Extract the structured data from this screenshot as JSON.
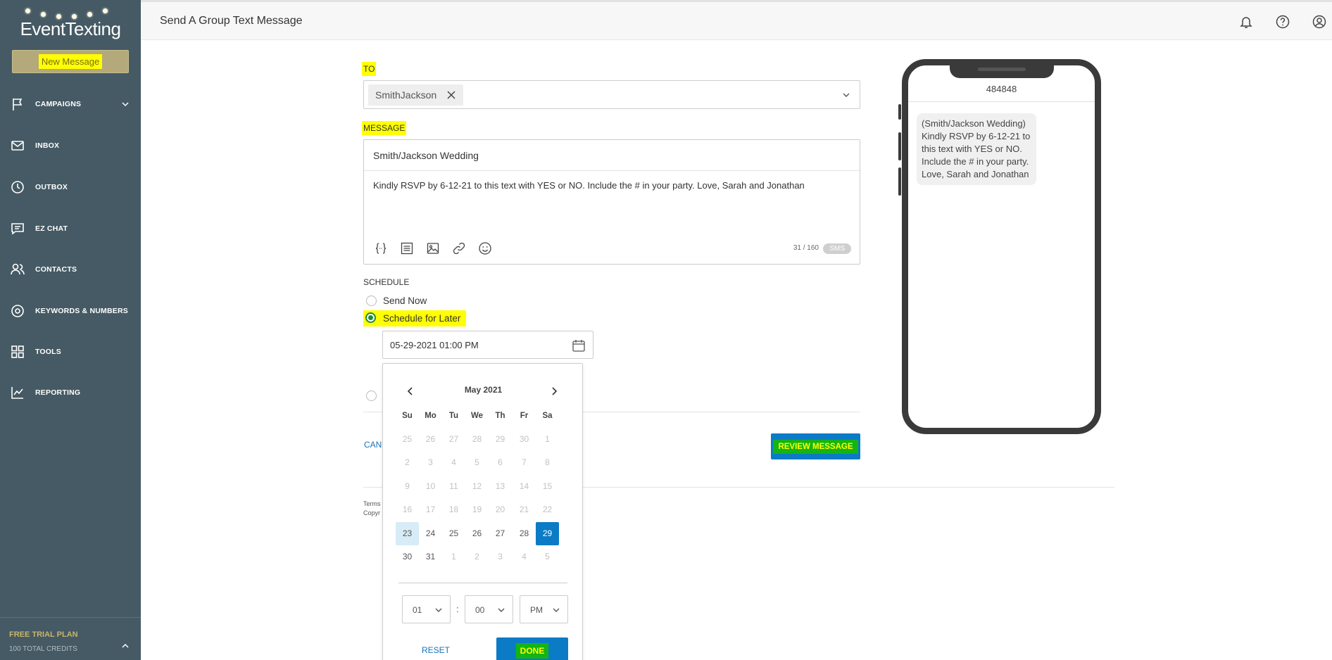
{
  "app": {
    "logo_text": "EventTexting",
    "page_title": "Send A Group Text Message"
  },
  "sidebar": {
    "new_message": "New Message",
    "items": [
      {
        "label": "CAMPAIGNS",
        "icon": "flag-icon"
      },
      {
        "label": "INBOX",
        "icon": "envelope-icon"
      },
      {
        "label": "OUTBOX",
        "icon": "clock-icon"
      },
      {
        "label": "EZ CHAT",
        "icon": "chat-icon"
      },
      {
        "label": "CONTACTS",
        "icon": "people-icon"
      },
      {
        "label": "KEYWORDS & NUMBERS",
        "icon": "target-icon"
      },
      {
        "label": "TOOLS",
        "icon": "grid-icon"
      },
      {
        "label": "REPORTING",
        "icon": "chart-icon"
      }
    ],
    "plan": "FREE TRIAL PLAN",
    "credits": "100 TOTAL CREDITS"
  },
  "form": {
    "to_label": "TO",
    "to_chip": "SmithJackson",
    "message_label": "MESSAGE",
    "subject": "Smith/Jackson Wedding",
    "body": "Kindly RSVP by 6-12-21 to this text with YES or NO. Include the # in your party. Love, Sarah and Jonathan",
    "counter": "31 / 160",
    "badge": "SMS",
    "schedule_label": "SCHEDULE",
    "send_now": "Send Now",
    "schedule_later": "Schedule for Later",
    "datetime": "05-29-2021 01:00 PM",
    "cancel": "CANC",
    "review": "REVIEW MESSAGE",
    "terms": "Terms",
    "copyright": "Copyr"
  },
  "datepicker": {
    "month": "May 2021",
    "dow": [
      "Su",
      "Mo",
      "Tu",
      "We",
      "Th",
      "Fr",
      "Sa"
    ],
    "weeks": [
      [
        [
          "25",
          "m"
        ],
        [
          "26",
          "m"
        ],
        [
          "27",
          "m"
        ],
        [
          "28",
          "m"
        ],
        [
          "29",
          "m"
        ],
        [
          "30",
          "m"
        ],
        [
          "1",
          "m"
        ]
      ],
      [
        [
          "2",
          "m"
        ],
        [
          "3",
          "m"
        ],
        [
          "4",
          "m"
        ],
        [
          "5",
          "m"
        ],
        [
          "6",
          "m"
        ],
        [
          "7",
          "m"
        ],
        [
          "8",
          "m"
        ]
      ],
      [
        [
          "9",
          "m"
        ],
        [
          "10",
          "m"
        ],
        [
          "11",
          "m"
        ],
        [
          "12",
          "m"
        ],
        [
          "13",
          "m"
        ],
        [
          "14",
          "m"
        ],
        [
          "15",
          "m"
        ]
      ],
      [
        [
          "16",
          "m"
        ],
        [
          "17",
          "m"
        ],
        [
          "18",
          "m"
        ],
        [
          "19",
          "m"
        ],
        [
          "20",
          "m"
        ],
        [
          "21",
          "m"
        ],
        [
          "22",
          "m"
        ]
      ],
      [
        [
          "23",
          "today"
        ],
        [
          "24",
          ""
        ],
        [
          "25",
          ""
        ],
        [
          "26",
          ""
        ],
        [
          "27",
          ""
        ],
        [
          "28",
          ""
        ],
        [
          "29",
          "sel"
        ]
      ],
      [
        [
          "30",
          ""
        ],
        [
          "31",
          ""
        ],
        [
          "1",
          "m"
        ],
        [
          "2",
          "m"
        ],
        [
          "3",
          "m"
        ],
        [
          "4",
          "m"
        ],
        [
          "5",
          "m"
        ]
      ]
    ],
    "hour": "01",
    "minute": "00",
    "ampm": "PM",
    "colon": ":",
    "reset": "RESET",
    "done": "DONE"
  },
  "preview": {
    "number": "484848",
    "bubble": "(Smith/Jackson Wedding) Kindly RSVP by 6-12-21 to this text with YES or NO. Include the # in your party. Love, Sarah and Jonathan"
  },
  "colors": {
    "sidebar": "#455a64",
    "accent": "#0c7bc6",
    "highlight": "#ffff00",
    "selected_radio": "#1b8a3a"
  }
}
